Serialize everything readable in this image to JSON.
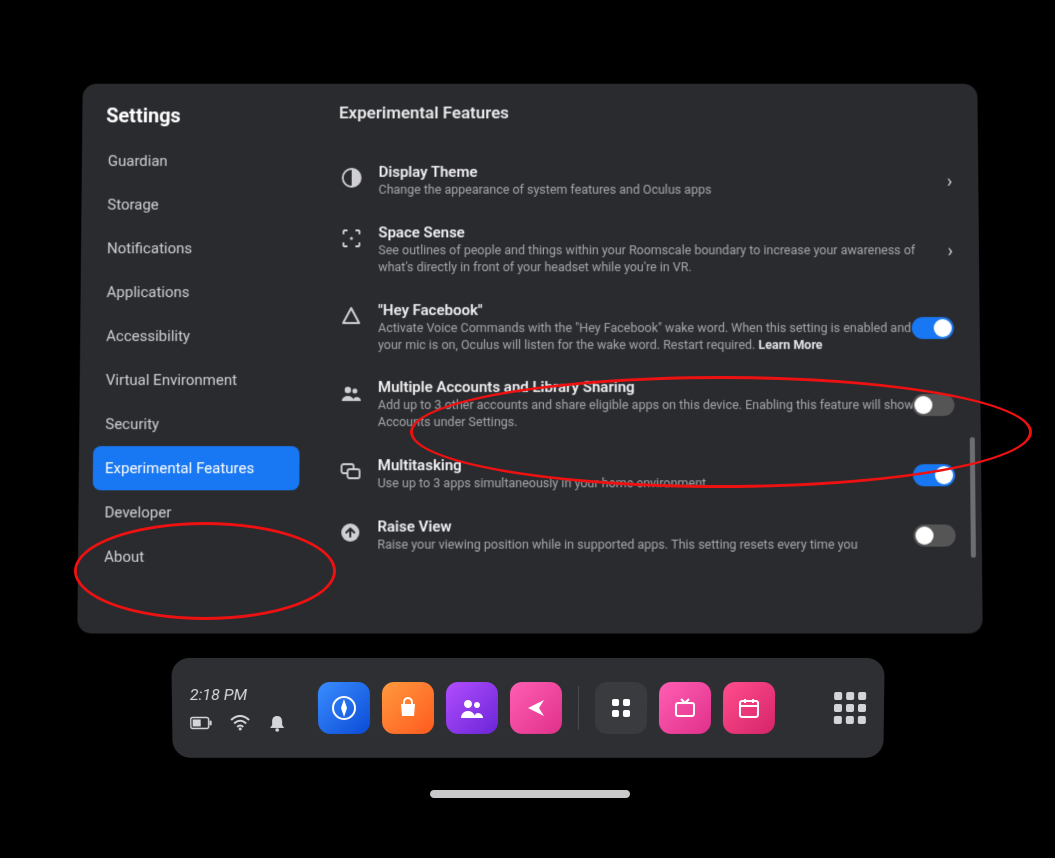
{
  "sidebar": {
    "title": "Settings",
    "items": [
      {
        "label": "Guardian"
      },
      {
        "label": "Storage"
      },
      {
        "label": "Notifications"
      },
      {
        "label": "Applications"
      },
      {
        "label": "Accessibility"
      },
      {
        "label": "Virtual Environment"
      },
      {
        "label": "Security"
      },
      {
        "label": "Experimental Features",
        "active": true
      },
      {
        "label": "Developer"
      },
      {
        "label": "About"
      }
    ]
  },
  "content": {
    "title": "Experimental Features",
    "rows": [
      {
        "icon": "theme",
        "title": "Display Theme",
        "desc": "Change the appearance of system features and Oculus apps",
        "action": "chevron"
      },
      {
        "icon": "space",
        "title": "Space Sense",
        "desc": "See outlines of people and things within your Roomscale boundary to increase your awareness of what's directly in front of your headset while you're in VR.",
        "action": "chevron"
      },
      {
        "icon": "voice",
        "title": "\"Hey Facebook\"",
        "desc": "Activate Voice Commands with the \"Hey Facebook\" wake word. When this setting is enabled and your mic is on, Oculus will listen for the wake word. Restart required. ",
        "bold": "Learn More",
        "action": "toggle",
        "on": true
      },
      {
        "icon": "accounts",
        "title": "Multiple Accounts and Library Sharing",
        "desc": "Add up to 3 other accounts and share eligible apps on this device. Enabling this feature will show Accounts under Settings.",
        "action": "toggle",
        "on": false
      },
      {
        "icon": "multi",
        "title": "Multitasking",
        "desc": "Use up to 3 apps simultaneously in your home environment.",
        "action": "toggle",
        "on": true
      },
      {
        "icon": "raise",
        "title": "Raise View",
        "desc": "Raise your viewing position while in supported apps. This setting resets every time you",
        "action": "toggle",
        "on": false
      }
    ]
  },
  "dock": {
    "clock": "2:18 PM",
    "status": {
      "battery": "battery",
      "wifi": "wifi",
      "bell": "bell"
    },
    "apps": [
      {
        "name": "explore",
        "grad": "grad-blue",
        "glyph": "compass"
      },
      {
        "name": "store",
        "grad": "grad-orange",
        "glyph": "bag"
      },
      {
        "name": "people",
        "grad": "grad-purple",
        "glyph": "people"
      },
      {
        "name": "share",
        "grad": "grad-pink",
        "glyph": "share"
      },
      {
        "sep": true
      },
      {
        "name": "library",
        "grad": "flat-dark",
        "glyph": "squares"
      },
      {
        "name": "tv",
        "grad": "grad-pink",
        "glyph": "tv"
      },
      {
        "name": "events",
        "grad": "grad-pink2",
        "glyph": "cal"
      }
    ]
  }
}
